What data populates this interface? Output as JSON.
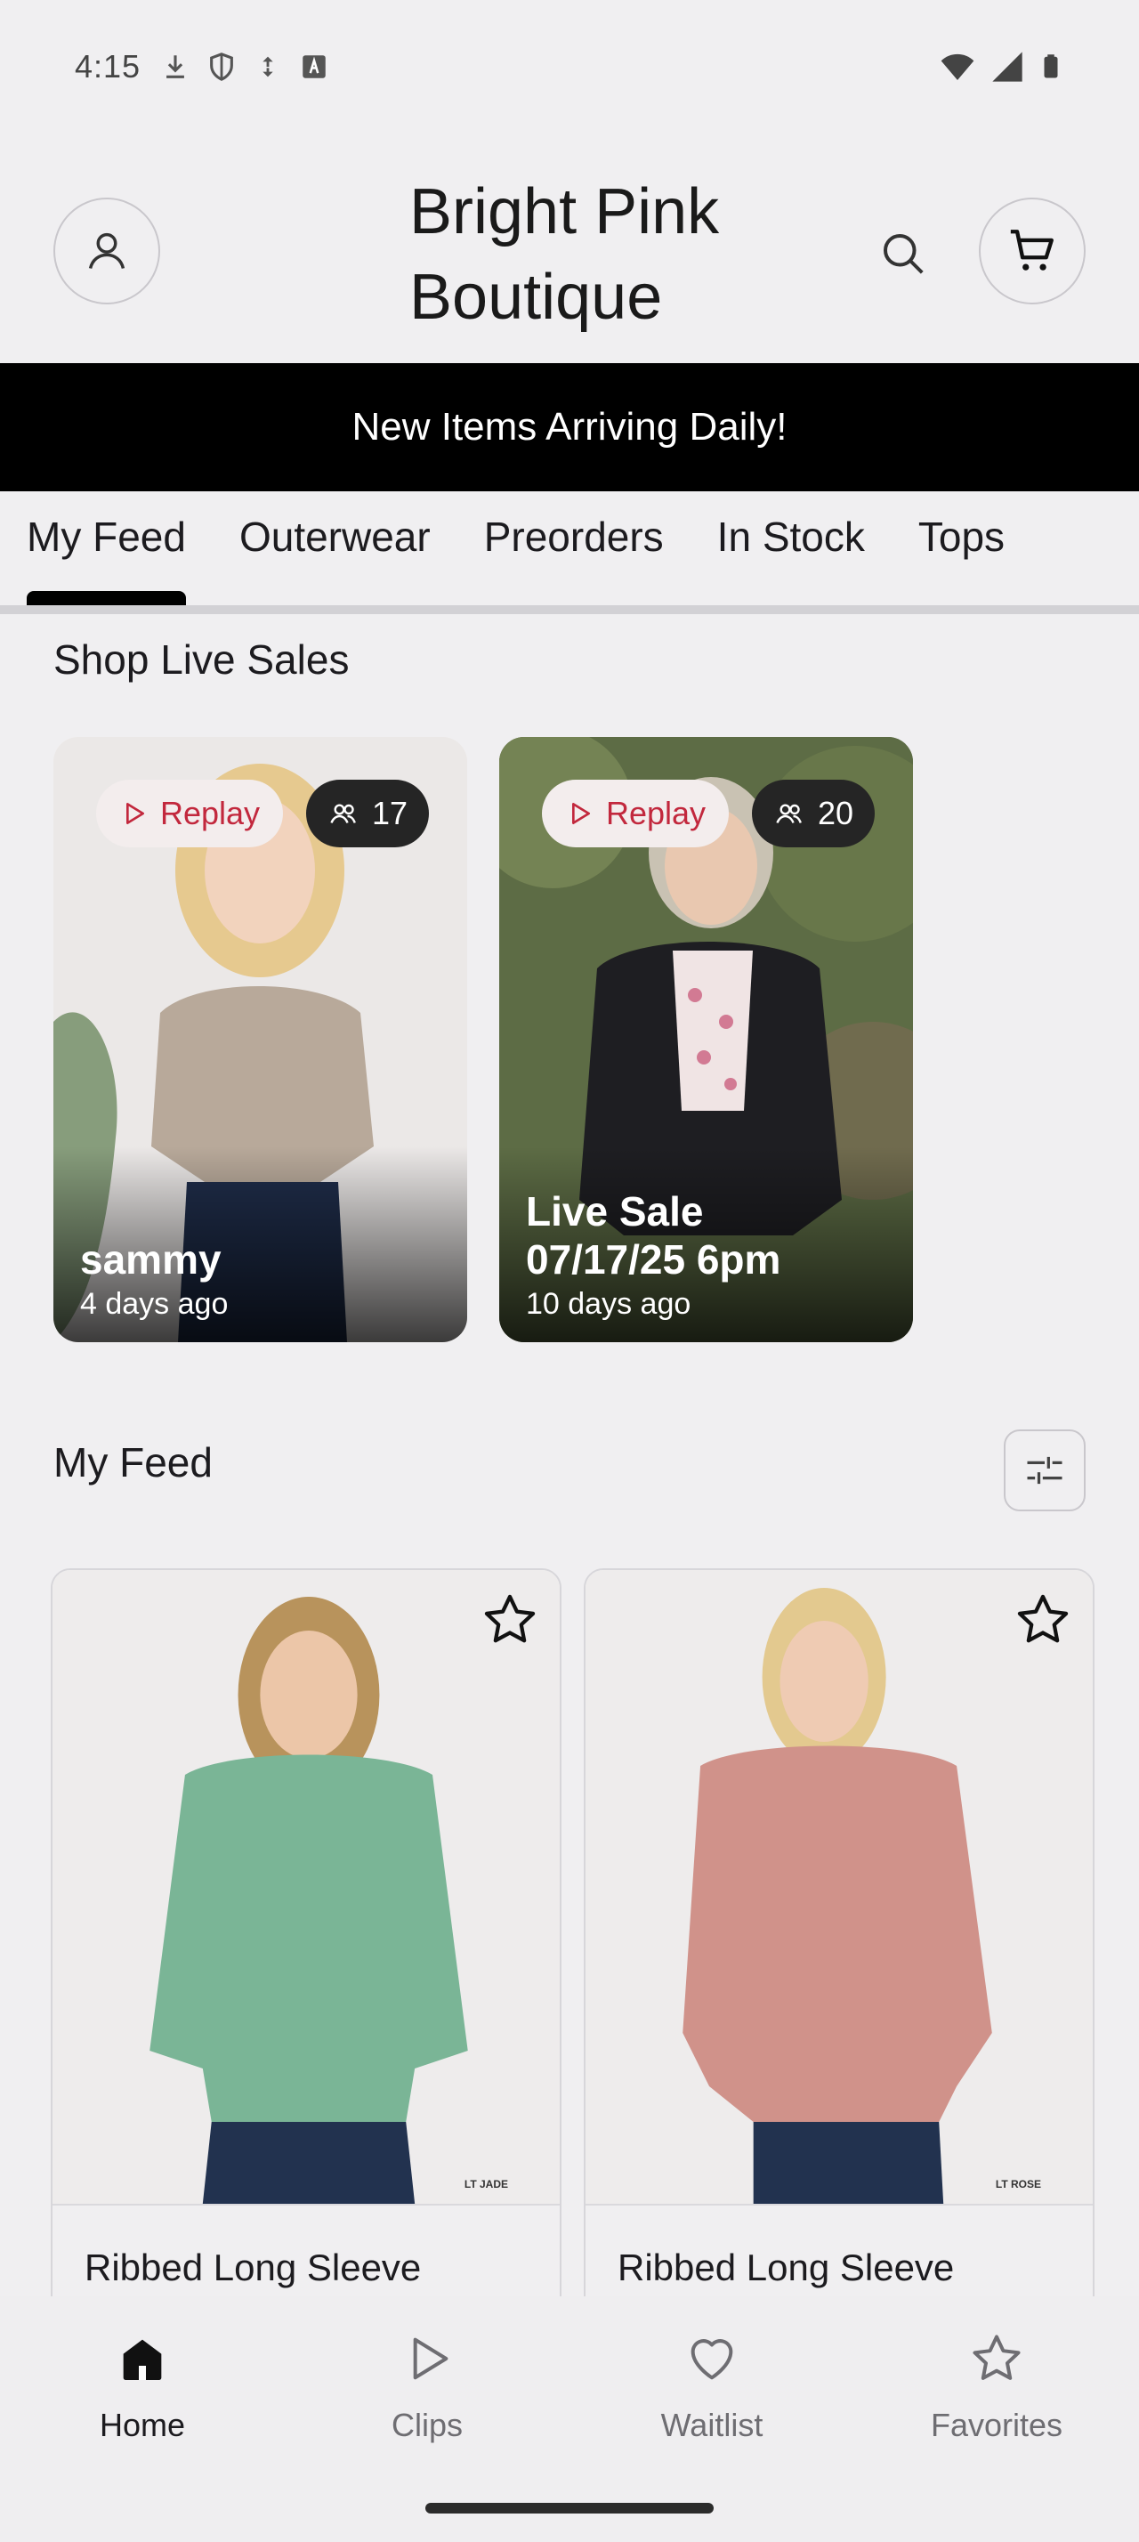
{
  "status_bar": {
    "time": "4:15",
    "icons": [
      "download-icon",
      "shield-icon",
      "data-saver-icon",
      "keyboard-a-icon"
    ],
    "right_icons": [
      "wifi-icon",
      "signal-icon",
      "battery-icon"
    ]
  },
  "header": {
    "brand": "Bright Pink Boutique"
  },
  "banner": {
    "text": "New Items Arriving Daily!"
  },
  "tabs": [
    {
      "label": "My Feed",
      "active": true
    },
    {
      "label": "Outerwear"
    },
    {
      "label": "Preorders"
    },
    {
      "label": "In Stock"
    },
    {
      "label": "Tops"
    }
  ],
  "live_section": {
    "title": "Shop Live Sales",
    "cards": [
      {
        "replay": "Replay",
        "viewers": "17",
        "name": "sammy",
        "time": "4 days ago"
      },
      {
        "replay": "Replay",
        "viewers": "20",
        "name": "Live Sale 07/17/25 6pm",
        "time": "10 days ago"
      }
    ]
  },
  "feed_section": {
    "title": "My Feed",
    "products": [
      {
        "name": "Ribbed Long Sleeve",
        "tag": "LT JADE",
        "color": "#7ab596"
      },
      {
        "name": "Ribbed Long Sleeve",
        "tag": "LT ROSE",
        "color": "#d0928a"
      }
    ]
  },
  "bottom_nav": [
    {
      "label": "Home",
      "icon": "home-icon",
      "active": true
    },
    {
      "label": "Clips",
      "icon": "play-icon"
    },
    {
      "label": "Waitlist",
      "icon": "heart-icon"
    },
    {
      "label": "Favorites",
      "icon": "star-icon"
    }
  ],
  "colors": {
    "replay_accent": "#c2283d",
    "banner_bg": "#000000"
  }
}
